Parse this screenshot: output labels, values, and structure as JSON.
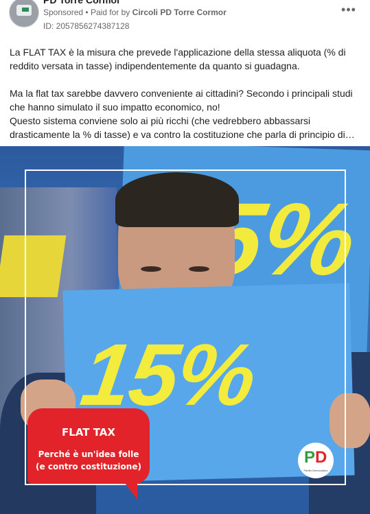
{
  "header": {
    "page_name": "PD Torre Cormor",
    "sponsored_label": "Sponsored",
    "separator": "•",
    "paid_for_by": "Paid for by",
    "paid_for_by_entity": "Circoli PD Torre Cormor",
    "ad_id": "ID: 2057856274387128",
    "more_icon": "more-horizontal-icon",
    "more_glyph": "•••"
  },
  "post": {
    "paragraph1": "La FLAT TAX è la misura che prevede l'applicazione della stessa aliquota (% di reddito versata in tasse) indipendentemente da quanto si guadagna.",
    "paragraph2": "Ma la flat tax sarebbe davvero conveniente ai cittadini? Secondo i principali studi che hanno simulato il suo impatto economico, no!",
    "paragraph3": "Questo sistema conviene solo ai più ricchi (che vedrebbero abbassarsi drasticamente la % di tasse) e va contro la costituzione che parla di principio di…"
  },
  "image": {
    "back_sign_text": "5%",
    "front_sign_text": "15%",
    "callout_title": "FLAT TAX",
    "callout_line1": "Perché è un'idea folle",
    "callout_line2": "(e contro costituzione)",
    "logo_p": "P",
    "logo_d": "D",
    "logo_tag": "Partito Democratico",
    "colors": {
      "callout_red": "#e3232a",
      "sign_blue": "#58a7ea",
      "sign_yellow": "#f4ec3c",
      "pd_green": "#2e9e3e"
    }
  }
}
